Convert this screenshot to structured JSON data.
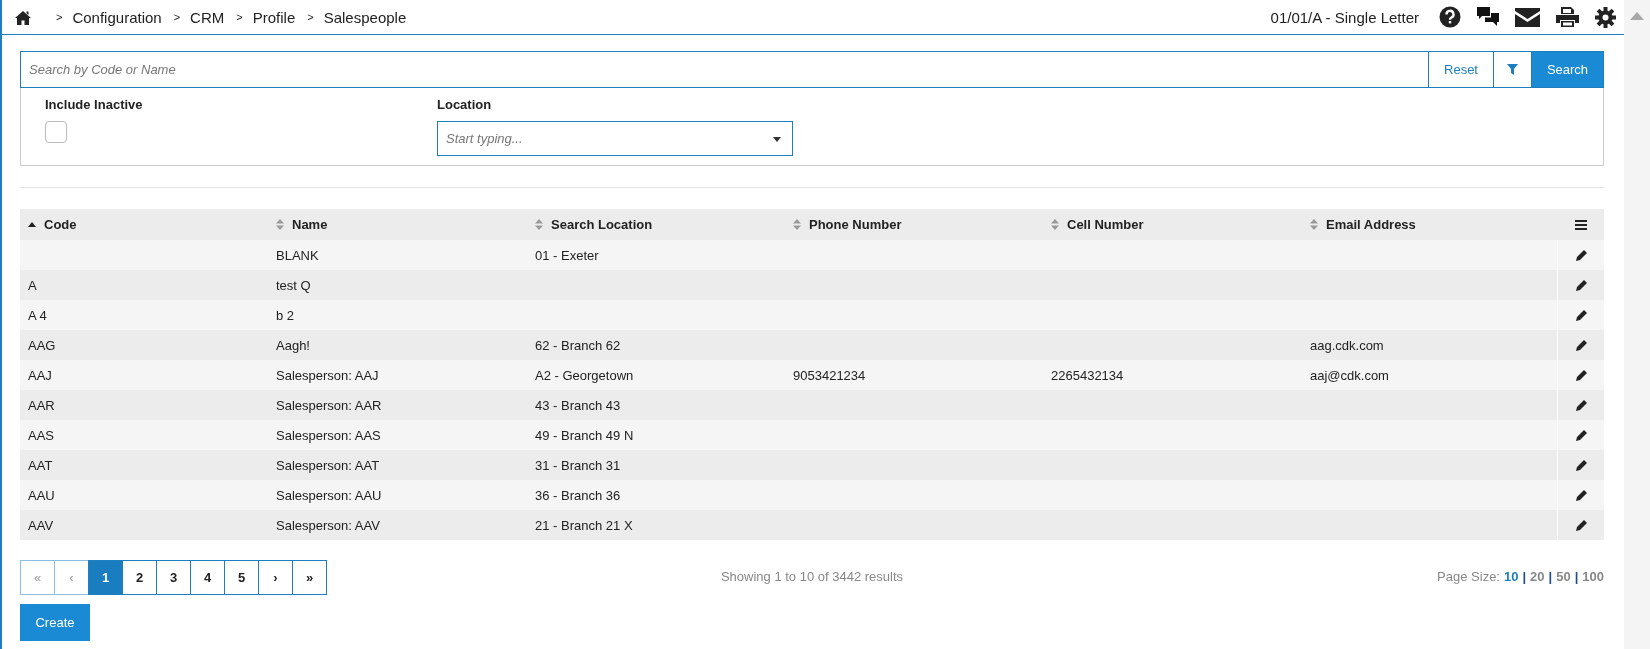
{
  "header": {
    "breadcrumb": [
      {
        "sep": ">",
        "label": "Configuration"
      },
      {
        "sep": ">",
        "label": "CRM"
      },
      {
        "sep": ">",
        "label": "Profile"
      },
      {
        "sep": ">",
        "label": "Salespeople"
      }
    ],
    "context": "01/01/A - Single Letter"
  },
  "search": {
    "placeholder": "Search by Code or Name",
    "reset": "Reset",
    "submit": "Search"
  },
  "filters": {
    "include_inactive": {
      "label": "Include Inactive",
      "checked": false
    },
    "location": {
      "label": "Location",
      "placeholder": "Start typing..."
    }
  },
  "table": {
    "columns": [
      {
        "label": "Code",
        "sorted": true
      },
      {
        "label": "Name",
        "sorted": false
      },
      {
        "label": "Search Location",
        "sorted": false
      },
      {
        "label": "Phone Number",
        "sorted": false
      },
      {
        "label": "Cell Number",
        "sorted": false
      },
      {
        "label": "Email Address",
        "sorted": false
      }
    ],
    "rows": [
      [
        "",
        "BLANK",
        "01 - Exeter",
        "",
        "",
        ""
      ],
      [
        "A",
        "test Q",
        "",
        "",
        "",
        ""
      ],
      [
        "A 4",
        "b 2",
        "",
        "",
        "",
        ""
      ],
      [
        "AAG",
        "Aagh!",
        "62 - Branch 62",
        "",
        "",
        "aag.cdk.com"
      ],
      [
        "AAJ",
        "Salesperson: AAJ",
        "A2 - Georgetown",
        "9053421234",
        "2265432134",
        "aaj@cdk.com"
      ],
      [
        "AAR",
        "Salesperson: AAR",
        "43 - Branch 43",
        "",
        "",
        ""
      ],
      [
        "AAS",
        "Salesperson: AAS",
        "49 - Branch 49 N",
        "",
        "",
        ""
      ],
      [
        "AAT",
        "Salesperson: AAT",
        "31 - Branch 31",
        "",
        "",
        ""
      ],
      [
        "AAU",
        "Salesperson: AAU",
        "36 - Branch 36",
        "",
        "",
        ""
      ],
      [
        "AAV",
        "Salesperson: AAV",
        "21 - Branch 21 X",
        "",
        "",
        ""
      ]
    ]
  },
  "pagination": {
    "controls": [
      {
        "kind": "nav",
        "label": "«",
        "disabled": true
      },
      {
        "kind": "nav",
        "label": "‹",
        "disabled": true
      },
      {
        "kind": "page",
        "label": "1",
        "selected": true
      },
      {
        "kind": "page",
        "label": "2",
        "selected": false
      },
      {
        "kind": "page",
        "label": "3",
        "selected": false
      },
      {
        "kind": "page",
        "label": "4",
        "selected": false
      },
      {
        "kind": "page",
        "label": "5",
        "selected": false
      },
      {
        "kind": "nav",
        "label": "›",
        "disabled": false
      },
      {
        "kind": "nav",
        "label": "»",
        "disabled": false
      }
    ],
    "summary": "Showing 1 to 10 of 3442 results",
    "page_size": {
      "label": "Page Size:",
      "options": [
        {
          "label": "10",
          "selected": true
        },
        {
          "sep": "|",
          "label": "20",
          "selected": false
        },
        {
          "sep": "|",
          "label": "50",
          "selected": false
        },
        {
          "sep": "|",
          "label": "100",
          "selected": false
        }
      ]
    }
  },
  "create": "Create"
}
